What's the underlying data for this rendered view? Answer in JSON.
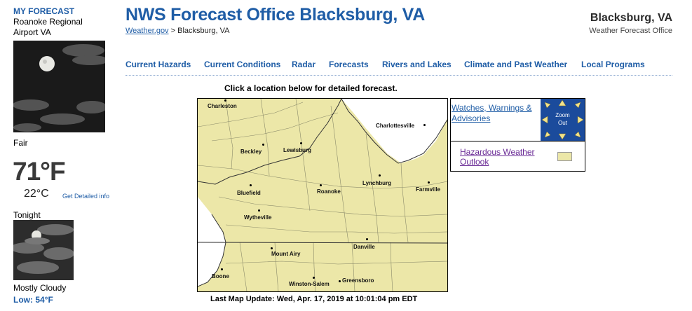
{
  "sidebar": {
    "my_forecast_label": "MY FORECAST",
    "location": "Roanoke Regional Airport VA",
    "condition": "Fair",
    "temp_f": "71°F",
    "temp_c": "22°C",
    "detail_link": "Get Detailed info",
    "tonight_label": "Tonight",
    "tonight_condition": "Mostly Cloudy",
    "tonight_low": "Low: 54°F"
  },
  "header": {
    "title": "NWS Forecast Office Blacksburg, VA",
    "breadcrumb_link": "Weather.gov",
    "breadcrumb_sep": ">",
    "breadcrumb_current": "Blacksburg, VA",
    "right_city": "Blacksburg, VA",
    "right_subtitle": "Weather Forecast Office"
  },
  "nav": {
    "items": [
      "Current Hazards",
      "Current Conditions",
      "Radar",
      "Forecasts",
      "Rivers and Lakes",
      "Climate and Past Weather",
      "Local Programs"
    ]
  },
  "map": {
    "prompt": "Click a location below for detailed forecast.",
    "last_update": "Last Map Update: Wed, Apr. 17, 2019 at 10:01:04 pm EDT",
    "fill_color": "#ece7a8",
    "cities": [
      "Charleston",
      "Beckley",
      "Lewisburg",
      "Charlottesville",
      "Bluefield",
      "Roanoke",
      "Lynchburg",
      "Farmville",
      "Wytheville",
      "Danville",
      "Mount Airy",
      "Boone",
      "Winston-Salem",
      "Greensboro"
    ]
  },
  "legend": {
    "watches_link": "Watches, Warnings & Advisories",
    "zoom_label": "Zoom Out",
    "hwo_link": "Hazardous Weather Outlook",
    "hwo_color": "#ece7a8"
  },
  "colors": {
    "link": "#1f5da6",
    "zoom_bg": "#1b4b9c",
    "zoom_arrow": "#f2e28a"
  },
  "icons": [
    "moon-cloud-icon",
    "moon-cloud-tonight-icon",
    "zoom-arrow-icon"
  ]
}
